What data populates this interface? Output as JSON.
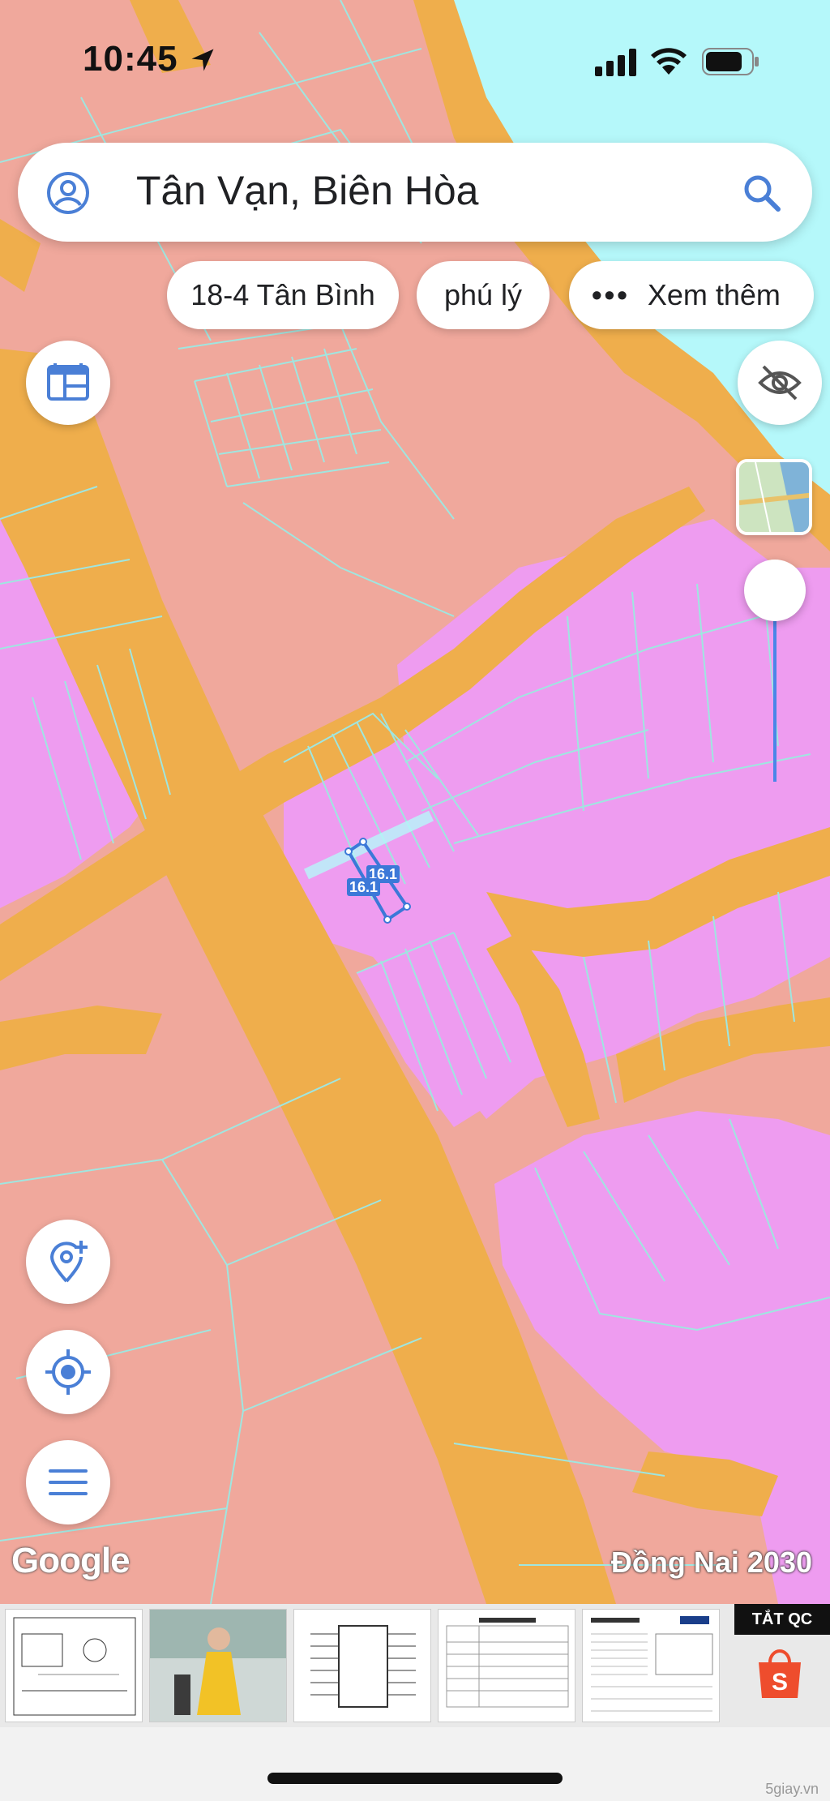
{
  "status_bar": {
    "time": "10:45"
  },
  "search": {
    "query": "Tân Vạn, Biên Hòa"
  },
  "chips": [
    {
      "label": "18-4 Tân Bình"
    },
    {
      "label": "phú lý"
    },
    {
      "label": "Xem thêm",
      "prefix": "•••"
    }
  ],
  "map": {
    "attribution": "Google",
    "plan_caption": "Đồng Nai 2030",
    "measurement_labels": [
      "16.1",
      "16.1"
    ],
    "colors": {
      "residential": "#f0a89c",
      "commercial": "#ee9cf0",
      "road": "#efae4c",
      "water": "#b5f8fa",
      "parcel_line": "#9fe6e0",
      "accent_blue": "#3c78d8"
    }
  },
  "ads": {
    "close_label": "TẮT QC",
    "items": [
      {
        "icon": "schematic-ad"
      },
      {
        "icon": "dress-ad"
      },
      {
        "icon": "chip-diagram-ad"
      },
      {
        "icon": "product-label-ad"
      },
      {
        "icon": "datasheet-ad"
      }
    ],
    "shop_icon": "shopping-bag-icon"
  },
  "watermark": "5giay.vn"
}
